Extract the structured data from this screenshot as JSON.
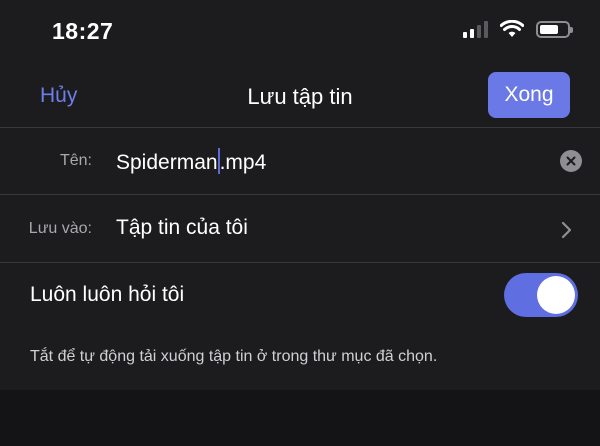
{
  "status_bar": {
    "time": "18:27"
  },
  "nav": {
    "cancel_label": "Hủy",
    "title": "Lưu tập tin",
    "done_label": "Xong"
  },
  "name_row": {
    "label": "Tên:",
    "value_before_caret": "Spiderman",
    "value_after_caret": ".mp4"
  },
  "location_row": {
    "label": "Lưu vào:",
    "value": "Tập tin của tôi"
  },
  "always_ask_row": {
    "label": "Luôn luôn hỏi tôi",
    "toggle_on": true
  },
  "footer": {
    "hint": "Tắt để tự động tải xuống tập tin ở trong thư mục đã chọn."
  },
  "colors": {
    "accent": "#6a79e6",
    "background": "#1c1c1e",
    "divider": "#38383a"
  }
}
